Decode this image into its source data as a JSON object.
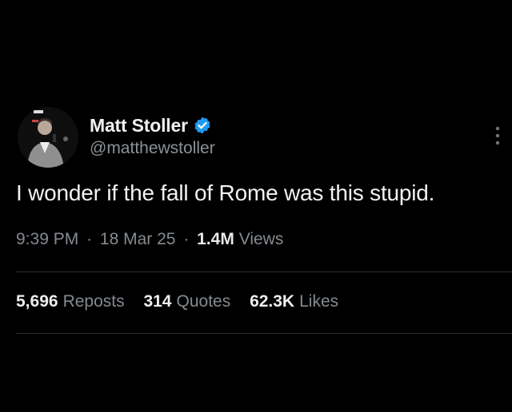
{
  "author": {
    "display_name": "Matt Stoller",
    "handle": "@matthewstoller",
    "verified_color": "#1d9bf0"
  },
  "tweet": {
    "text": "I wonder if the fall of Rome was this stupid."
  },
  "meta": {
    "time": "9:39 PM",
    "separator": "·",
    "date": "18 Mar 25",
    "views_count": "1.4M",
    "views_label": "Views"
  },
  "stats": {
    "reposts_count": "5,696",
    "reposts_label": "Reposts",
    "quotes_count": "314",
    "quotes_label": "Quotes",
    "likes_count": "62.3K",
    "likes_label": "Likes"
  },
  "icons": {
    "avatar": "avatar-photo",
    "verified": "verified-badge-icon",
    "more": "more-options-icon"
  }
}
